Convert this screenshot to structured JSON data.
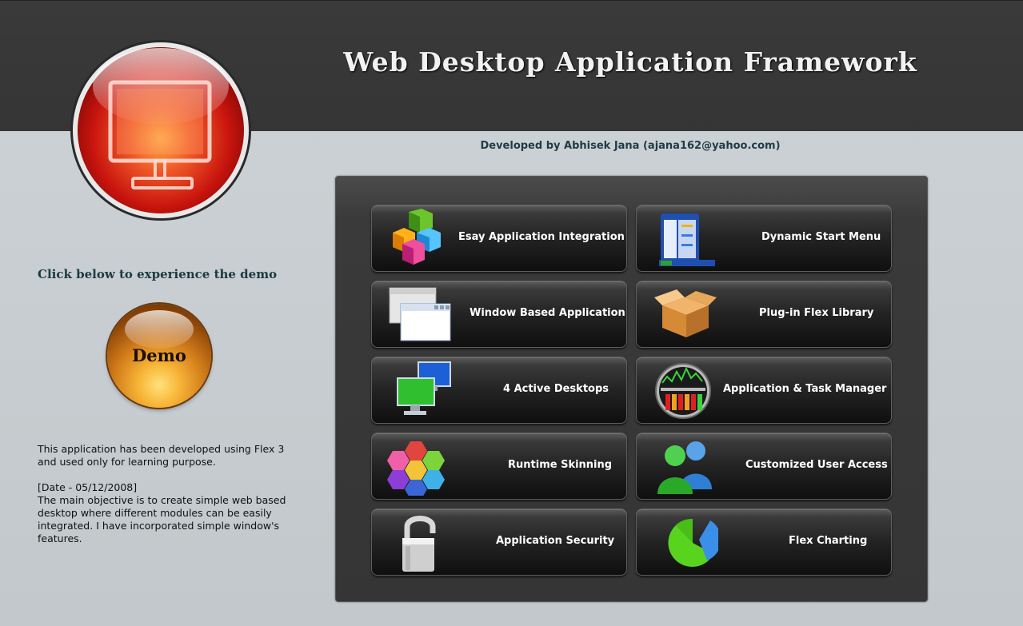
{
  "header": {
    "title": "Web Desktop Application Framework",
    "developer": "Developed by Abhisek Jana (ajana162@yahoo.com)"
  },
  "logo": {
    "icon": "monitor-icon",
    "color": "#d8221a"
  },
  "left": {
    "heading": "Click below to experience the demo",
    "demo_label": "Demo",
    "description": [
      "This application has been developed using Flex 3 and used only for learning purpose.",
      "[Date - 05/12/2008]",
      "The main objective is to create simple web based desktop where different modules can be easily integrated. I have incorporated simple window's features."
    ]
  },
  "features": [
    {
      "label": "Esay Application Integration",
      "icon": "cubes-icon"
    },
    {
      "label": "Dynamic Start Menu",
      "icon": "start-menu-icon"
    },
    {
      "label": "Window Based Application",
      "icon": "windows-icon"
    },
    {
      "label": "Plug-in Flex Library",
      "icon": "package-box-icon"
    },
    {
      "label": "4 Active Desktops",
      "icon": "monitors-icon"
    },
    {
      "label": "Application & Task Manager",
      "icon": "task-manager-icon"
    },
    {
      "label": "Runtime Skinning",
      "icon": "hexagon-palette-icon"
    },
    {
      "label": "Customized User Access",
      "icon": "users-icon"
    },
    {
      "label": "Application Security",
      "icon": "padlock-icon"
    },
    {
      "label": "Flex Charting",
      "icon": "pie-chart-icon"
    }
  ]
}
